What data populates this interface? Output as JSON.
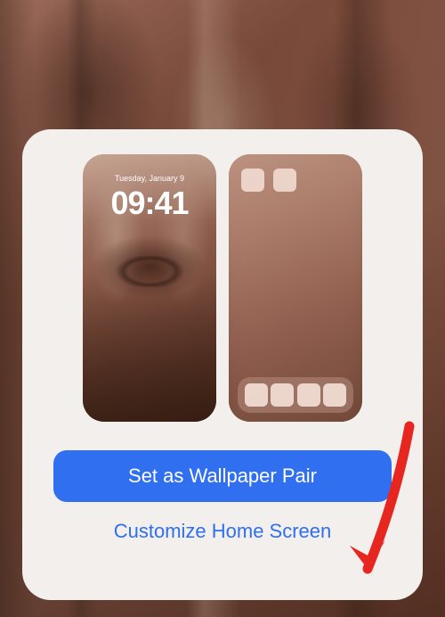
{
  "background": {
    "tint": "#8b5a4a"
  },
  "modal": {
    "lock_preview": {
      "date_label": "Tuesday, January 9",
      "time_label": "09:41"
    },
    "primary_button_label": "Set as Wallpaper Pair",
    "secondary_button_label": "Customize Home Screen"
  },
  "annotation": {
    "arrow_color": "#e6261f"
  }
}
